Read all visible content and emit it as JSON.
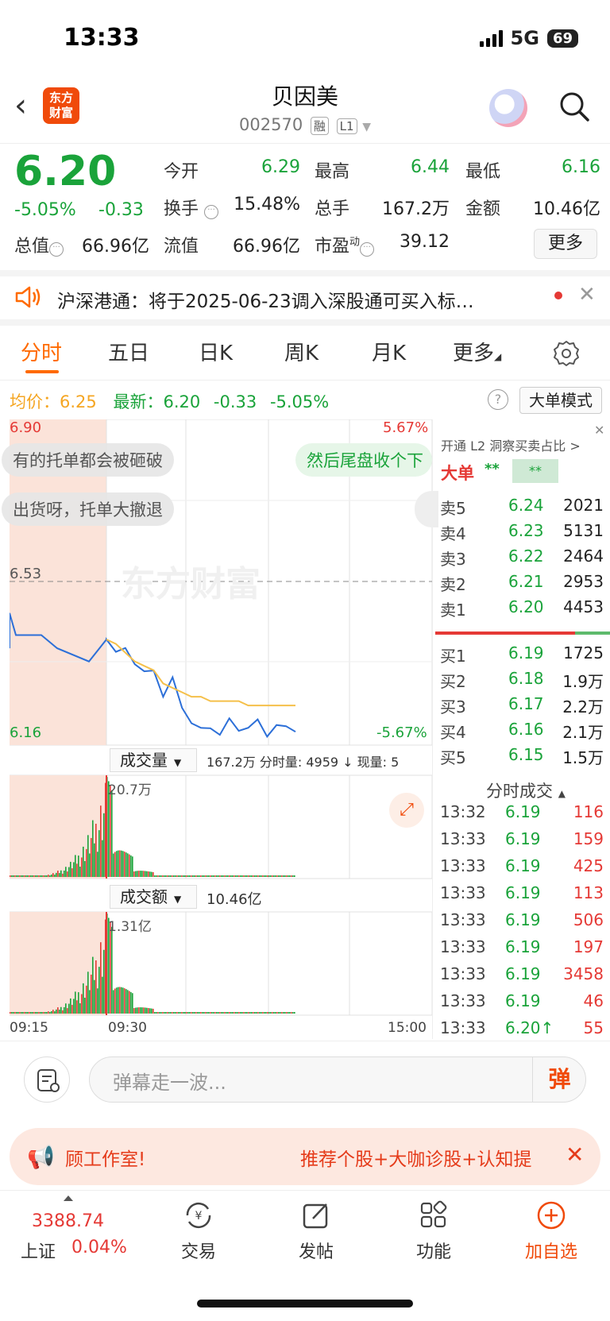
{
  "status": {
    "time": "13:33",
    "network": "5G",
    "battery": "69"
  },
  "header": {
    "name": "贝因美",
    "code": "002570",
    "tag1": "融",
    "tag2": "L1",
    "logo_line1": "东方",
    "logo_line2": "财富"
  },
  "quote": {
    "price": "6.20",
    "change_pct": "-5.05%",
    "change": "-0.33",
    "open_label": "今开",
    "open": "6.29",
    "high_label": "最高",
    "high": "6.44",
    "low_label": "最低",
    "low": "6.16",
    "turnover_label": "换手",
    "turnover": "15.48%",
    "volume_label": "总手",
    "volume": "167.2万",
    "amount_label": "金额",
    "amount": "10.46亿",
    "mktcap_label": "总值",
    "mktcap": "66.96亿",
    "float_label": "流值",
    "float_cap": "66.96亿",
    "pe_label": "市盈",
    "pe_sup": "动",
    "pe": "39.12",
    "more": "更多"
  },
  "notice": {
    "text": "沪深港通：将于2025-06-23调入深股通可买入标…"
  },
  "tabs": [
    "分时",
    "五日",
    "日K",
    "周K",
    "月K",
    "更多"
  ],
  "avg_row": {
    "avg_label": "均价：",
    "avg": "6.25",
    "last_label": "最新：",
    "last": "6.20",
    "chg": "-0.33",
    "pct": "-5.05%"
  },
  "mode_button": "大单模式",
  "chart": {
    "price_top": "6.90",
    "price_mid": "6.53",
    "price_bot": "6.16",
    "pct_top": "5.67%",
    "pct_bot": "-5.67%",
    "watermark": "东方财富",
    "danmu": [
      "有的托单都会被砸破",
      "出货呀，托单大撤退",
      "然后尾盘收个下"
    ],
    "vol_label": "成交量",
    "vol_info": "167.2万 分时量: 4959 ↓ 现量: 5",
    "vol_max": "20.7万",
    "amt_label": "成交额",
    "amt_info": "10.46亿",
    "amt_max": "1.31亿",
    "time_start": "09:15",
    "time_open": "09:30",
    "time_end": "15:00"
  },
  "chart_data": {
    "type": "line",
    "title": "",
    "x": [
      "09:30",
      "09:35",
      "09:40",
      "09:45",
      "09:50",
      "09:55",
      "10:00",
      "10:10",
      "10:20",
      "10:30",
      "10:40",
      "10:50",
      "11:00",
      "11:10",
      "11:20",
      "11:30",
      "13:00",
      "13:10",
      "13:20",
      "13:30",
      "13:33"
    ],
    "series": [
      {
        "name": "",
        "values": [
          6.4,
          6.38,
          6.37,
          6.35,
          6.33,
          6.32,
          6.28,
          6.31,
          6.24,
          6.22,
          6.19,
          6.2,
          6.19,
          6.21,
          6.2,
          6.2,
          6.21,
          6.19,
          6.2,
          6.2,
          6.2
        ]
      },
      {
        "name": "均价",
        "values": [
          6.4,
          6.39,
          6.37,
          6.35,
          6.34,
          6.33,
          6.3,
          6.29,
          6.28,
          6.27,
          6.27,
          6.26,
          6.26,
          6.26,
          6.26,
          6.25,
          6.25,
          6.25,
          6.25,
          6.25,
          6.25
        ]
      }
    ],
    "ylim": [
      6.16,
      6.9
    ],
    "prev_close": 6.53
  },
  "orderbook": {
    "title": "开通 L2 洞察买卖占比 >",
    "big_label": "大单",
    "big_v1": "**",
    "big_v2": "**",
    "asks": [
      {
        "label": "卖5",
        "price": "6.24",
        "vol": "2021"
      },
      {
        "label": "卖4",
        "price": "6.23",
        "vol": "5131"
      },
      {
        "label": "卖3",
        "price": "6.22",
        "vol": "2464"
      },
      {
        "label": "卖2",
        "price": "6.21",
        "vol": "2953"
      },
      {
        "label": "卖1",
        "price": "6.20",
        "vol": "4453"
      }
    ],
    "bids": [
      {
        "label": "买1",
        "price": "6.19",
        "vol": "1725"
      },
      {
        "label": "买2",
        "price": "6.18",
        "vol": "1.9万"
      },
      {
        "label": "买3",
        "price": "6.17",
        "vol": "2.2万"
      },
      {
        "label": "买4",
        "price": "6.16",
        "vol": "2.1万"
      },
      {
        "label": "买5",
        "price": "6.15",
        "vol": "1.5万"
      }
    ],
    "trades_title": "分时成交",
    "trades": [
      {
        "time": "13:32",
        "price": "6.19",
        "vol": "116"
      },
      {
        "time": "13:33",
        "price": "6.19",
        "vol": "159"
      },
      {
        "time": "13:33",
        "price": "6.19",
        "vol": "425"
      },
      {
        "time": "13:33",
        "price": "6.19",
        "vol": "113"
      },
      {
        "time": "13:33",
        "price": "6.19",
        "vol": "506"
      },
      {
        "time": "13:33",
        "price": "6.19",
        "vol": "197"
      },
      {
        "time": "13:33",
        "price": "6.19",
        "vol": "3458"
      },
      {
        "time": "13:33",
        "price": "6.19",
        "vol": "46"
      },
      {
        "time": "13:33",
        "price": "6.20↑",
        "vol": "55"
      }
    ]
  },
  "comment": {
    "placeholder": "弹幕走一波...",
    "danmu_btn": "弹"
  },
  "ad": {
    "left": "顾工作室!",
    "right": "推荐个股+大咖诊股+认知提"
  },
  "bottom_nav": {
    "index_value": "3388.74",
    "index_name": "上证",
    "index_pct": "0.04%",
    "items": [
      "交易",
      "发帖",
      "功能",
      "加自选"
    ]
  },
  "colors": {
    "up": "#e53935",
    "down": "#1aa33a",
    "accent": "#ff6a00"
  }
}
